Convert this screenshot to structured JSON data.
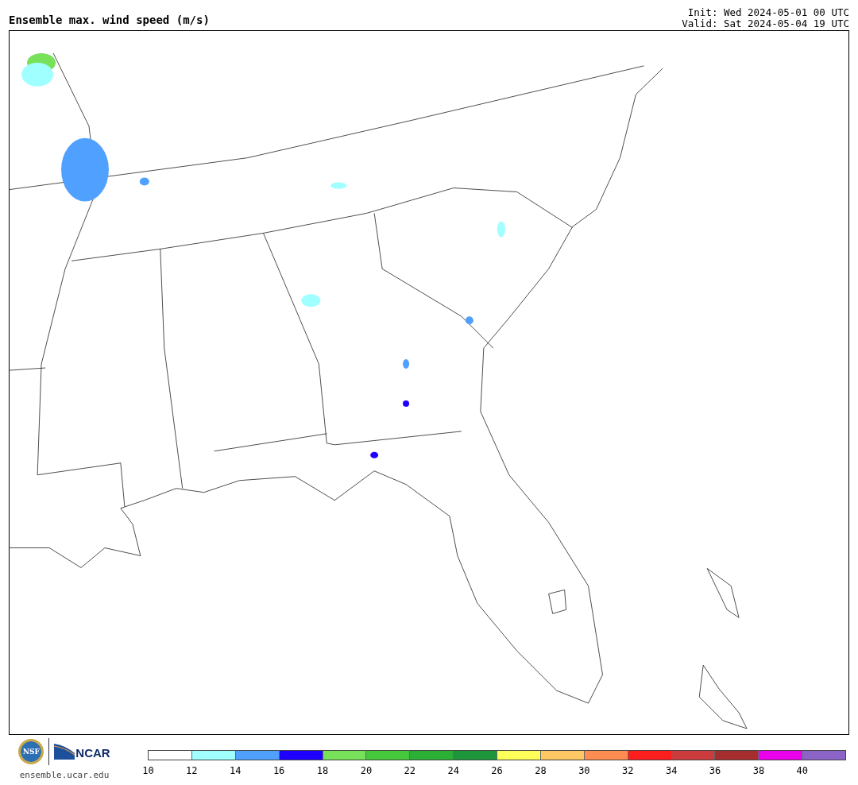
{
  "header": {
    "title": "Ensemble max. wind speed (m/s)",
    "init": "Init: Wed 2024-05-01 00 UTC",
    "valid": "Valid: Sat 2024-05-04 19 UTC"
  },
  "footer": {
    "seal_text": "NSF",
    "logo_text": "NCAR",
    "url": "ensemble.ucar.edu"
  },
  "legend": {
    "bins": [
      {
        "color": "#ffffff"
      },
      {
        "color": "#a0ffff"
      },
      {
        "color": "#50a0ff"
      },
      {
        "color": "#1e00ff"
      },
      {
        "color": "#78e15a"
      },
      {
        "color": "#46c83c"
      },
      {
        "color": "#2caf35"
      },
      {
        "color": "#1e963c"
      },
      {
        "color": "#ffff5a"
      },
      {
        "color": "#ffc864"
      },
      {
        "color": "#ff8c50"
      },
      {
        "color": "#ff1e1e"
      },
      {
        "color": "#cd3c3c"
      },
      {
        "color": "#a52d2d"
      },
      {
        "color": "#eb00eb"
      },
      {
        "color": "#8c64c8"
      }
    ],
    "ticks": [
      "10",
      "12",
      "14",
      "16",
      "18",
      "20",
      "22",
      "24",
      "26",
      "28",
      "30",
      "32",
      "34",
      "36",
      "38",
      "40"
    ]
  }
}
